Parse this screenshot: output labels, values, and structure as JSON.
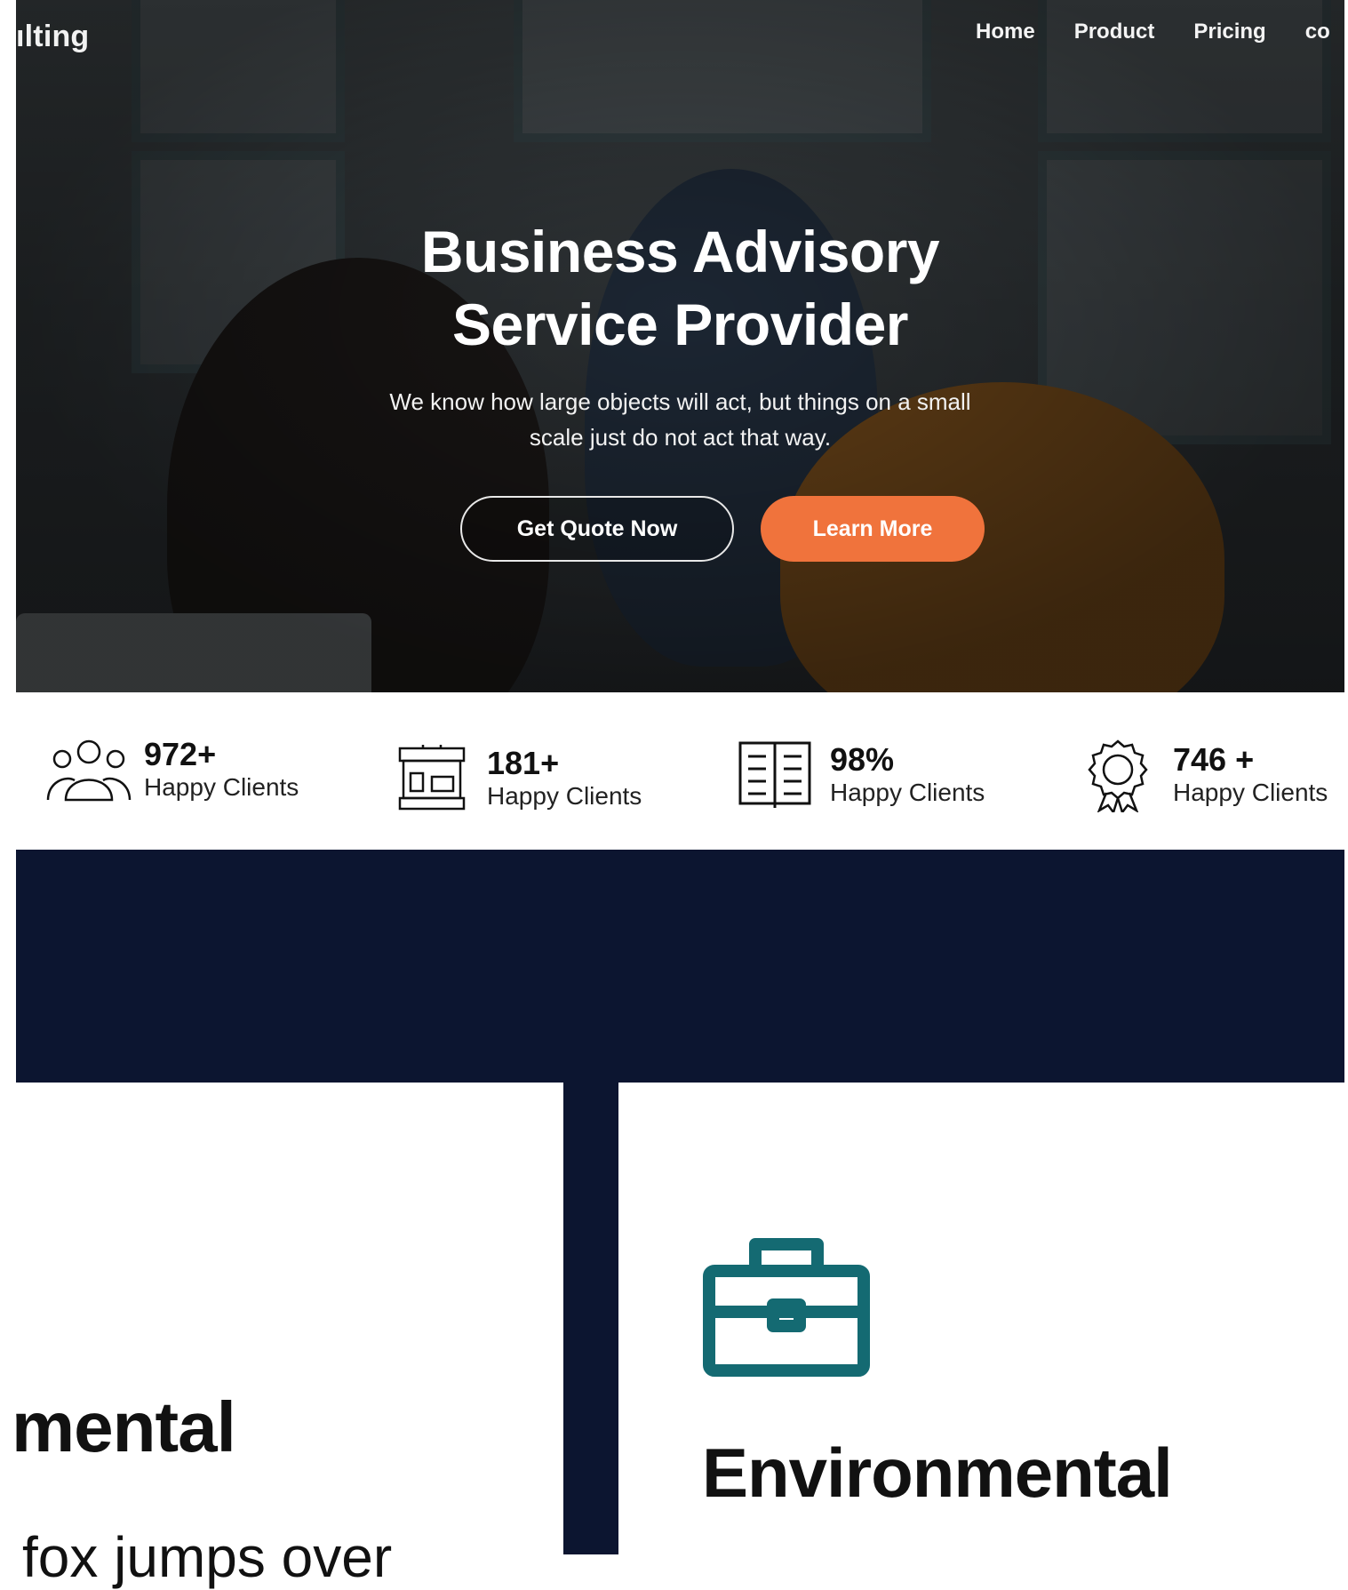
{
  "header": {
    "brand": "ılting",
    "nav": [
      "Home",
      "Product",
      "Pricing",
      "co"
    ]
  },
  "hero": {
    "title_line1": "Business Advisory",
    "title_line2": "Service Provider",
    "subtitle_line1": "We know how large objects will act, but things on a small",
    "subtitle_line2": "scale just do not act that way.",
    "primary_button": "Get Quote Now",
    "secondary_button": "Learn More",
    "accent_color": "#f0733c"
  },
  "stats": [
    {
      "icon": "users-icon",
      "value": "972+",
      "label": "Happy Clients"
    },
    {
      "icon": "storefront-icon",
      "value": "181+",
      "label": "Happy Clients"
    },
    {
      "icon": "book-icon",
      "value": "98%",
      "label": "Happy Clients"
    },
    {
      "icon": "award-icon",
      "value": "746 +",
      "label": "Happy Clients"
    }
  ],
  "features": {
    "left_title": "mental",
    "left_text": "fox jumps over",
    "right_icon": "briefcase-icon",
    "right_title": "Environmental"
  },
  "colors": {
    "dark_band": "#0c1530",
    "icon_teal": "#146a72"
  }
}
